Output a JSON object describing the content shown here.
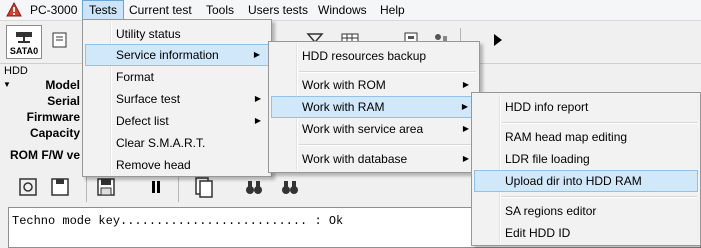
{
  "menubar": {
    "items": [
      "PC-3000",
      "Tests",
      "Current test",
      "Tools",
      "Users tests",
      "Windows",
      "Help"
    ]
  },
  "toolbar": {
    "sata_label": "SATA0"
  },
  "hdd_panel": {
    "title": "HDD",
    "labels": [
      "Model",
      "Serial",
      "Firmware",
      "Capacity"
    ]
  },
  "rom_fw_label": "ROM F/W ve",
  "log": {
    "line": "Techno mode key.......................... : Ok"
  },
  "tests_menu": {
    "items": [
      {
        "label": "Utility status",
        "submenu": false
      },
      {
        "label": "Service information",
        "submenu": true
      },
      {
        "label": "Format",
        "submenu": false
      },
      {
        "label": "Surface test",
        "submenu": true
      },
      {
        "label": "Defect list",
        "submenu": true
      },
      {
        "label": "Clear S.M.A.R.T.",
        "submenu": false
      },
      {
        "label": "Remove head",
        "submenu": false
      }
    ]
  },
  "service_menu": {
    "items": [
      {
        "label": "HDD resources backup",
        "submenu": false
      },
      {
        "label": "Work with ROM",
        "submenu": true
      },
      {
        "label": "Work with RAM",
        "submenu": true
      },
      {
        "label": "Work with service area",
        "submenu": true
      },
      {
        "label": "Work with database",
        "submenu": true
      }
    ]
  },
  "ram_menu": {
    "items": [
      {
        "label": "HDD info report"
      },
      {
        "label": "RAM head map editing"
      },
      {
        "label": "LDR file loading"
      },
      {
        "label": "Upload dir into HDD RAM"
      },
      {
        "label": "SA regions editor"
      },
      {
        "label": "Edit HDD ID"
      }
    ]
  },
  "colors": {
    "highlight": "#d1e8fb",
    "highlight_border": "#8ec3f0",
    "menubar_active": "#cce4f7"
  }
}
